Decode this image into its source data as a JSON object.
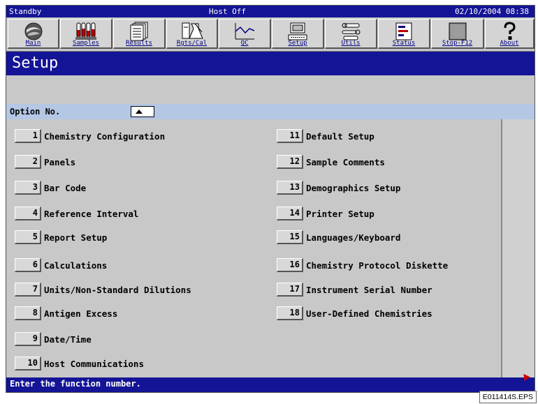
{
  "status_bar": {
    "left": "Standby",
    "center": "Host Off",
    "datetime": "02/10/2004 08:38"
  },
  "toolbar": [
    {
      "label": "Main",
      "icon": "globe-icon"
    },
    {
      "label": "Samples",
      "icon": "test-tubes-icon"
    },
    {
      "label": "Results",
      "icon": "documents-stack-icon"
    },
    {
      "label": "Rgts/Cal",
      "icon": "flask-icon"
    },
    {
      "label": "QC",
      "icon": "chart-line-icon"
    },
    {
      "label": "Setup",
      "icon": "computer-icon"
    },
    {
      "label": "Utils",
      "icon": "tools-icon"
    },
    {
      "label": "Status",
      "icon": "status-panel-icon"
    },
    {
      "label": "Stop-F12",
      "icon": "stop-square-icon"
    },
    {
      "label": "About",
      "icon": "question-icon"
    }
  ],
  "title": "Setup",
  "option_row": {
    "label": "Option No.",
    "value": ""
  },
  "options_left": [
    {
      "num": "1",
      "label": "Chemistry Configuration"
    },
    {
      "num": "2",
      "label": "Panels"
    },
    {
      "num": "3",
      "label": "Bar Code"
    },
    {
      "num": "4",
      "label": "Reference Interval"
    },
    {
      "num": "5",
      "label": "Report Setup"
    },
    {
      "num": "6",
      "label": "Calculations"
    },
    {
      "num": "7",
      "label": "Units/Non-Standard Dilutions"
    },
    {
      "num": "8",
      "label": "Antigen Excess"
    },
    {
      "num": "9",
      "label": "Date/Time"
    },
    {
      "num": "10",
      "label": "Host Communications"
    }
  ],
  "options_right": [
    {
      "num": "11",
      "label": "Default Setup"
    },
    {
      "num": "12",
      "label": "Sample Comments"
    },
    {
      "num": "13",
      "label": "Demographics Setup"
    },
    {
      "num": "14",
      "label": "Printer Setup"
    },
    {
      "num": "15",
      "label": "Languages/Keyboard"
    },
    {
      "num": "16",
      "label": "Chemistry Protocol Diskette"
    },
    {
      "num": "17",
      "label": "Instrument Serial Number"
    },
    {
      "num": "18",
      "label": "User-Defined Chemistries"
    }
  ],
  "message": "Enter the function number.",
  "caption": "E011414S.EPS",
  "colors": {
    "bar_blue": "#141496",
    "option_row": "#b4c8e6",
    "background": "#c8c8c8"
  }
}
